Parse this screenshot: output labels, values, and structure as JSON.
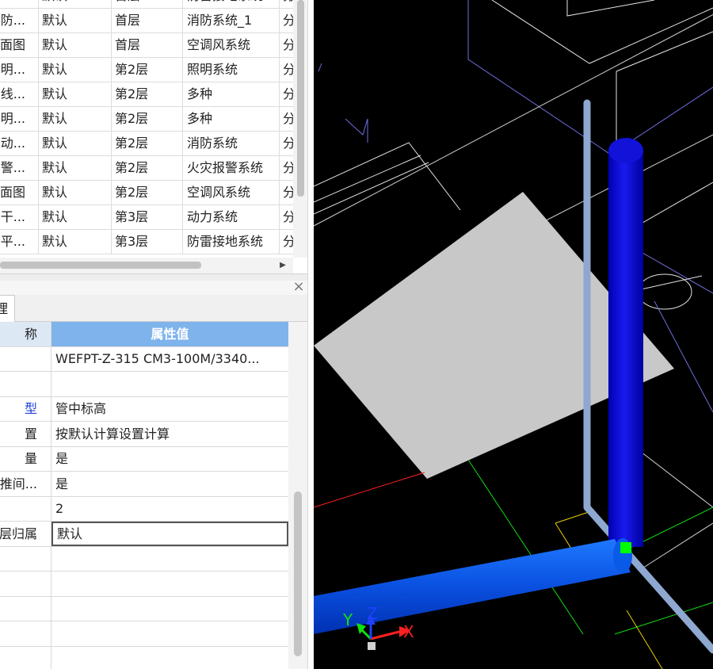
{
  "grid": {
    "rows": [
      [
        "",
        "默认",
        "首层",
        "防雷接地系统",
        "分"
      ],
      [
        "防...",
        "默认",
        "首层",
        "消防系统_1",
        "分"
      ],
      [
        "面图",
        "默认",
        "首层",
        "空调风系统",
        "分"
      ],
      [
        "明...",
        "默认",
        "第2层",
        "照明系统",
        "分"
      ],
      [
        "线...",
        "默认",
        "第2层",
        "多种",
        "分"
      ],
      [
        "明...",
        "默认",
        "第2层",
        "多种",
        "分"
      ],
      [
        "动...",
        "默认",
        "第2层",
        "消防系统",
        "分"
      ],
      [
        "警...",
        "默认",
        "第2层",
        "火灾报警系统",
        "分"
      ],
      [
        "面图",
        "默认",
        "第2层",
        "空调风系统",
        "分"
      ],
      [
        "干...",
        "默认",
        "第3层",
        "动力系统",
        "分"
      ],
      [
        "平...",
        "默认",
        "第3层",
        "防雷接地系统",
        "分"
      ]
    ]
  },
  "pane": {
    "tab_label": "理"
  },
  "properties": {
    "header": {
      "name": "称",
      "value": "属性值"
    },
    "rows": [
      {
        "name": "",
        "value": "WEFPT-Z-315 CM3-100M/3340...",
        "name_blue": false
      },
      {
        "name": "",
        "value": "",
        "name_blue": false
      },
      {
        "name": "型",
        "value": "管中标高",
        "name_blue": true
      },
      {
        "name": "置",
        "value": "按默认计算设置计算",
        "name_blue": false
      },
      {
        "name": "量",
        "value": "是",
        "name_blue": false
      },
      {
        "name": "推间...",
        "value": "是",
        "name_blue": false
      },
      {
        "name": "",
        "value": "2",
        "name_blue": false
      },
      {
        "name": "层归属",
        "value": "默认",
        "name_blue": false,
        "editing": true
      },
      {
        "name": "",
        "value": "",
        "name_blue": false
      },
      {
        "name": "",
        "value": "",
        "name_blue": false
      },
      {
        "name": "",
        "value": "",
        "name_blue": false
      },
      {
        "name": "",
        "value": "",
        "name_blue": false
      },
      {
        "name": "",
        "value": "",
        "name_blue": false
      }
    ]
  },
  "viewport": {
    "axes": {
      "x": "X",
      "y": "Y",
      "z": "Z"
    },
    "colors": {
      "background": "#000000",
      "pipe_blue": "#0000cc",
      "pipe_light": "#8ea8d0",
      "slab": "#c8c8c8",
      "axis_x": "#ff2020",
      "axis_y": "#10e010",
      "axis_z": "#2040ff",
      "grip": "#00ff00"
    }
  }
}
